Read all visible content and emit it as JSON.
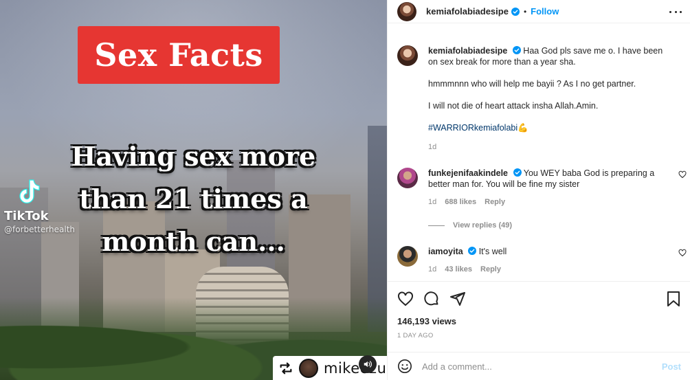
{
  "media": {
    "title_card": "Sex Facts",
    "caption_lines": [
      "Having sex more",
      "than 21 times a",
      "month can..."
    ],
    "watermark": {
      "brand": "TikTok",
      "handle": "@forbetterhealth"
    },
    "repost": {
      "username": "mikeezu"
    },
    "icons": {
      "mute": "speaker-icon",
      "repost": "repost-icon"
    }
  },
  "post": {
    "author": "kemiafolabiadesipe",
    "separator": "•",
    "follow_label": "Follow",
    "caption": {
      "line1": "Haa God pls save me o. I have been on sex break for more than a year sha.",
      "line2": "hmmmnnn who will help me bayii ? As I no get partner.",
      "line3": "I will not die of heart attack insha Allah.Amin.",
      "hashtag": "#WARRIORkemiafolabi",
      "emoji": "💪",
      "time": "1d"
    },
    "comments": [
      {
        "username": "funkejenifaakindele",
        "text": "You WEY baba God is preparing a better man for. You will be fine my sister",
        "time": "1d",
        "likes": "688 likes",
        "reply": "Reply",
        "view_replies": "View replies (49)"
      },
      {
        "username": "iamoyita",
        "text": "It's well",
        "time": "1d",
        "likes": "43 likes",
        "reply": "Reply"
      }
    ],
    "views": "146,193 views",
    "posted": "1 DAY AGO",
    "add_comment_placeholder": "Add a comment...",
    "post_label": "Post"
  },
  "colors": {
    "accent": "#0095f6",
    "title_red": "#e63632",
    "verified": "#0095f6"
  }
}
